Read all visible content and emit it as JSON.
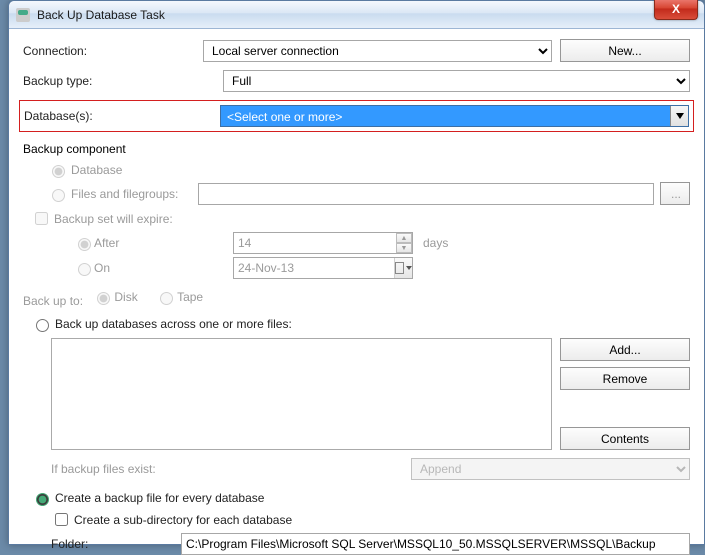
{
  "title": "Back Up Database Task",
  "buttons": {
    "close": "X",
    "new": "New...",
    "browse": "...",
    "add": "Add...",
    "remove": "Remove",
    "contents": "Contents"
  },
  "labels": {
    "connection": "Connection:",
    "backup_type": "Backup type:",
    "databases": "Database(s):",
    "backup_component": "Backup component",
    "database_radio": "Database",
    "files_filegroups": "Files and filegroups:",
    "expire_check": "Backup set will expire:",
    "after": "After",
    "on": "On",
    "days": "days",
    "backup_to": "Back up to:",
    "disk": "Disk",
    "tape": "Tape",
    "across_files": "Back up databases across one or more files:",
    "if_exist": "If backup files exist:",
    "per_db": "Create a backup file for every database",
    "subdir": "Create a sub-directory for each database",
    "folder": "Folder:"
  },
  "values": {
    "connection": "Local server connection",
    "backup_type": "Full",
    "databases": "<Select one or more>",
    "after_days": "14",
    "on_date": "24-Nov-13",
    "if_exist": "Append",
    "folder_path": "C:\\Program Files\\Microsoft SQL Server\\MSSQL10_50.MSSQLSERVER\\MSSQL\\Backup"
  }
}
